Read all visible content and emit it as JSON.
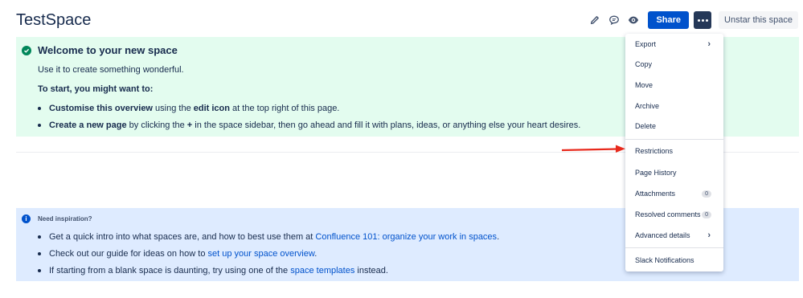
{
  "page": {
    "title": "TestSpace"
  },
  "toolbar": {
    "icons": [
      "pencil-icon",
      "comment-icon",
      "eye-icon"
    ],
    "share_label": "Share",
    "unstar_label": "Unstar this space"
  },
  "welcome": {
    "title": "Welcome to your new space",
    "subtitle": "Use it to create something wonderful.",
    "start": "To start, you might want to:",
    "bullet1": {
      "b1": "Customise this overview",
      "t1": " using the ",
      "b2": "edit icon",
      "t2": " at the top right of this page."
    },
    "bullet2": {
      "b1": "Create a new page",
      "t1": " by clicking the ",
      "b2": "+",
      "t2": " in the space sidebar, then go ahead and fill it with plans, ideas, or anything else your heart desires."
    }
  },
  "inspiration": {
    "title": "Need inspiration?",
    "bullet1": {
      "text": "Get a quick intro into what spaces are, and how to best use them at ",
      "link": "Confluence 101: organize your work in spaces",
      "end": "."
    },
    "bullet2": {
      "text": "Check out our guide for ideas on how to ",
      "link": "set up your space overview",
      "end": "."
    },
    "bullet3": {
      "text": "If starting from a blank space is daunting, try using one of the ",
      "link": "space templates",
      "end": " instead."
    }
  },
  "menu": {
    "export": "Export",
    "copy": "Copy",
    "move": "Move",
    "archive": "Archive",
    "delete": "Delete",
    "restrictions": "Restrictions",
    "page_history": "Page History",
    "attachments": "Attachments",
    "attachments_count": "0",
    "resolved_comments": "Resolved comments",
    "resolved_comments_count": "0",
    "advanced_details": "Advanced details",
    "slack_notifications": "Slack Notifications"
  },
  "colors": {
    "accent": "#0052cc",
    "success_bg": "#e3fcef",
    "info_bg": "#deebff",
    "annotation_arrow": "#e8291c"
  }
}
